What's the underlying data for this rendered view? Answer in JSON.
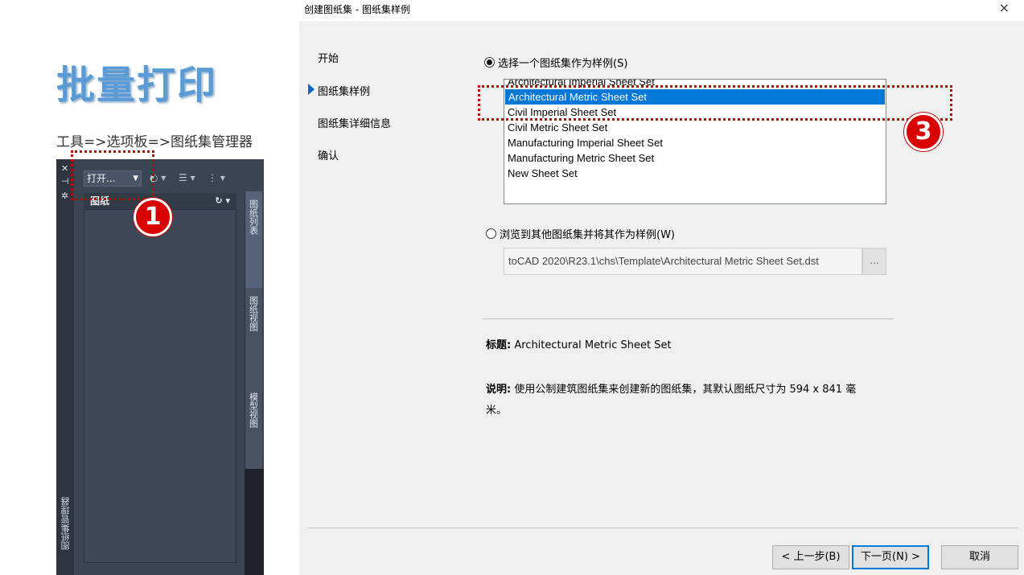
{
  "slide": {
    "title": "批量打印",
    "path": "工具=>选项板=>图纸集管理器"
  },
  "palette": {
    "open_label": "打开...",
    "tree_header": "图纸",
    "tabs": [
      "图纸列表",
      "图纸视图",
      "模型视图"
    ],
    "side_label": "图纸集管理器"
  },
  "dialog": {
    "title": "创建图纸集 - 图纸集样例",
    "close": "×",
    "nav": [
      "开始",
      "图纸集样例",
      "图纸集详细信息",
      "确认"
    ],
    "radio_select_label": "选择一个图纸集作为样例(S)",
    "sheet_sets": [
      "Architectural Imperial Sheet Set",
      "Architectural Metric Sheet Set",
      "Civil Imperial Sheet Set",
      "Civil Metric Sheet Set",
      "Manufacturing Imperial Sheet Set",
      "Manufacturing Metric Sheet Set",
      "New Sheet Set"
    ],
    "selected_index": 1,
    "radio_browse_label": "浏览到其他图纸集并将其作为样例(W)",
    "path_value": "toCAD 2020\\R23.1\\chs\\Template\\Architectural Metric Sheet Set.dst",
    "browse_label": "...",
    "title_label": "标题:",
    "title_value": "Architectural Metric Sheet Set",
    "desc_label": "说明:",
    "desc_value": "使用公制建筑图纸集来创建新的图纸集，其默认图纸尺寸为 594 x 841 毫米。",
    "back_label": "< 上一步(B)",
    "next_label": "下一页(N) >",
    "cancel_label": "取消"
  },
  "annotations": {
    "badge1": "1",
    "badge3": "3"
  },
  "colors": {
    "accent": "#0078d7",
    "annotation": "#d90000",
    "palette_bg": "#3b4453",
    "title_blue": "#5b9bd5"
  }
}
